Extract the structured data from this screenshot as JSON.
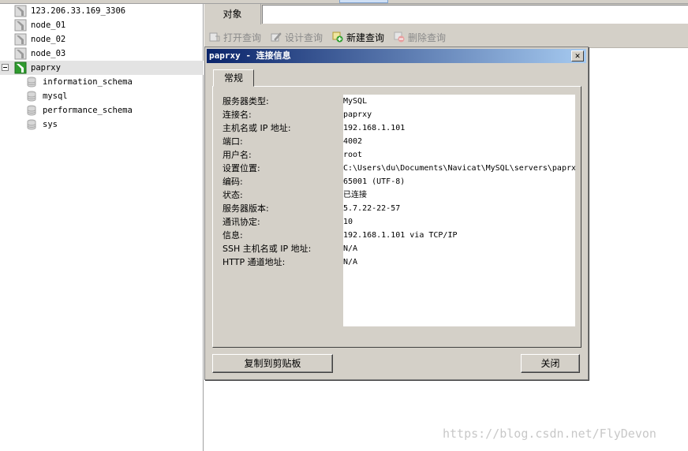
{
  "navigator": {
    "items": [
      {
        "label": "123.206.33.169_3306",
        "kind": "connection"
      },
      {
        "label": "node_01",
        "kind": "connection"
      },
      {
        "label": "node_02",
        "kind": "connection"
      },
      {
        "label": "node_03",
        "kind": "connection"
      },
      {
        "label": "paprxy",
        "kind": "connection-open"
      },
      {
        "label": "information_schema",
        "kind": "database"
      },
      {
        "label": "mysql",
        "kind": "database"
      },
      {
        "label": "performance_schema",
        "kind": "database"
      },
      {
        "label": "sys",
        "kind": "database"
      }
    ]
  },
  "object_tab": {
    "label": "对象"
  },
  "toolbar": {
    "open_query": "打开查询",
    "design_query": "设计查询",
    "new_query": "新建查询",
    "delete_query": "删除查询"
  },
  "dialog": {
    "title": "paprxy - 连接信息",
    "close_glyph": "✕",
    "tab_general": "常规",
    "properties": [
      {
        "key": "服务器类型:",
        "value": "MySQL"
      },
      {
        "key": "连接名:",
        "value": "paprxy"
      },
      {
        "key": "主机名或 IP 地址:",
        "value": "192.168.1.101"
      },
      {
        "key": "端口:",
        "value": "4002"
      },
      {
        "key": "用户名:",
        "value": "root"
      },
      {
        "key": "设置位置:",
        "value": "C:\\Users\\du\\Documents\\Navicat\\MySQL\\servers\\paprx"
      },
      {
        "key": "编码:",
        "value": "65001 (UTF-8)"
      },
      {
        "key": "状态:",
        "value": "已连接"
      },
      {
        "key": "服务器版本:",
        "value": "5.7.22-22-57"
      },
      {
        "key": "通讯协定:",
        "value": "10"
      },
      {
        "key": "信息:",
        "value": "192.168.1.101 via TCP/IP"
      },
      {
        "key": "SSH 主机名或 IP 地址:",
        "value": "N/A"
      },
      {
        "key": "HTTP 通道地址:",
        "value": "N/A"
      }
    ],
    "copy_button": "复制到剪贴板",
    "close_button": "关闭"
  },
  "watermark": "https://blog.csdn.net/FlyDevon",
  "colors": {
    "titlebar_start": "#0a246a",
    "titlebar_end": "#a6caf0",
    "connection_icon_green": "#2e9b2e",
    "new_query_plus": "#2f9e2f",
    "delete_query_minus": "#e05050"
  }
}
